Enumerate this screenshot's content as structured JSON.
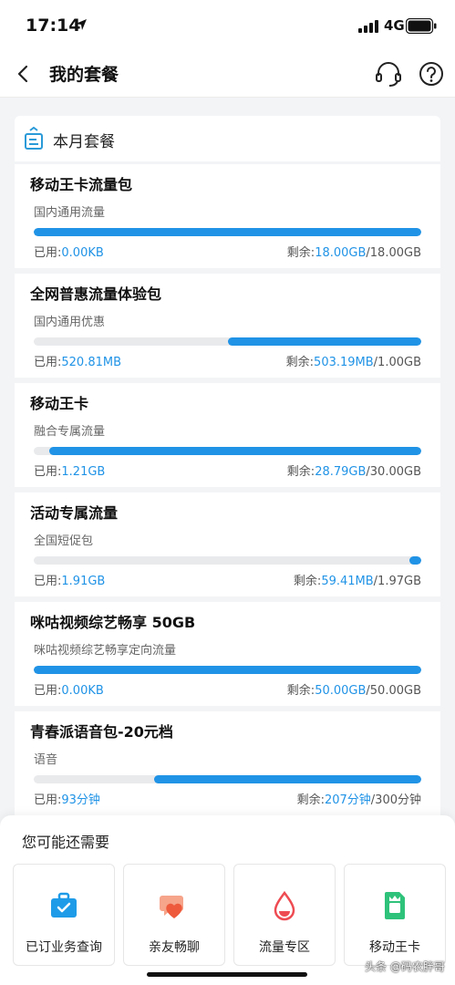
{
  "status_bar": {
    "time": "17:14",
    "network": "4G"
  },
  "nav": {
    "title": "我的套餐"
  },
  "month_header": {
    "label": "本月套餐"
  },
  "packages": [
    {
      "name": "移动王卡流量包",
      "desc": "国内通用流量",
      "used_label": "已用:",
      "used": "0.00KB",
      "remain_label": "剩余:",
      "remain": "18.00GB",
      "total": "/18.00GB",
      "remaining_fraction": 1.0
    },
    {
      "name": "全网普惠流量体验包",
      "desc": "国内通用优惠",
      "used_label": "已用:",
      "used": "520.81MB",
      "remain_label": "剩余:",
      "remain": "503.19MB",
      "total": "/1.00GB",
      "remaining_fraction": 0.5
    },
    {
      "name": "移动王卡",
      "desc": "融合专属流量",
      "used_label": "已用:",
      "used": "1.21GB",
      "remain_label": "剩余:",
      "remain": "28.79GB",
      "total": "/30.00GB",
      "remaining_fraction": 0.96
    },
    {
      "name": "活动专属流量",
      "desc": "全国短促包",
      "used_label": "已用:",
      "used": "1.91GB",
      "remain_label": "剩余:",
      "remain": "59.41MB",
      "total": "/1.97GB",
      "remaining_fraction": 0.03
    },
    {
      "name": "咪咕视频综艺畅享 50GB",
      "desc": "咪咕视频综艺畅享定向流量",
      "used_label": "已用:",
      "used": "0.00KB",
      "remain_label": "剩余:",
      "remain": "50.00GB",
      "total": "/50.00GB",
      "remaining_fraction": 1.0
    },
    {
      "name": "青春派语音包-20元档",
      "desc": "语音",
      "used_label": "已用:",
      "used": "93分钟",
      "remain_label": "剩余:",
      "remain": "207分钟",
      "total": "/300分钟",
      "remaining_fraction": 0.69
    }
  ],
  "recommend": {
    "title": "您可能还需要",
    "items": [
      {
        "label": "已订业务查询",
        "icon": "briefcase-icon",
        "color": "#1e9be8"
      },
      {
        "label": "亲友畅聊",
        "icon": "chat-heart-icon",
        "color": "#f26b4a"
      },
      {
        "label": "流量专区",
        "icon": "water-drop-icon",
        "color": "#ee4b52"
      },
      {
        "label": "移动王卡",
        "icon": "sim-card-icon",
        "color": "#2ec27a"
      }
    ]
  },
  "watermark": "头条 @码农胖哥",
  "colors": {
    "accent": "#2093e6",
    "track": "#e9eaec"
  }
}
